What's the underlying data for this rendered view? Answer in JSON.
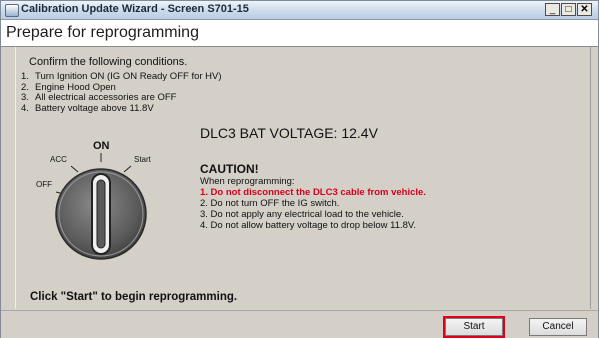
{
  "window": {
    "title": "Calibration Update Wizard - Screen S701-15",
    "controls": {
      "minimize": "_",
      "maximize": "□",
      "close": "✕"
    }
  },
  "header": {
    "title": "Prepare for reprogramming"
  },
  "main": {
    "confirm_text": "Confirm the following conditions.",
    "conditions": [
      {
        "num": "1.",
        "text": "Turn Ignition ON (IG ON Ready OFF for HV)"
      },
      {
        "num": "2.",
        "text": "Engine Hood Open"
      },
      {
        "num": "3.",
        "text": "All electrical accessories are OFF"
      },
      {
        "num": "4.",
        "text": "Battery voltage above 11.8V"
      }
    ],
    "voltage_text": "DLC3 BAT VOLTAGE: 12.4V",
    "ignition": {
      "label_on": "ON",
      "label_acc": "ACC",
      "label_start": "Start",
      "label_off": "OFF"
    },
    "caution": {
      "title": "CAUTION!",
      "intro": "When reprogramming:",
      "items": [
        {
          "text": "1. Do not disconnect the DLC3 cable from vehicle."
        },
        {
          "text": "2. Do not turn OFF the IG switch."
        },
        {
          "text": "3. Do not apply any electrical load to the vehicle."
        },
        {
          "text": "4. Do not allow battery voltage to drop below 11.8V."
        }
      ]
    },
    "instruction": "Click \"Start\" to begin reprogramming."
  },
  "footer": {
    "start_label": "Start",
    "cancel_label": "Cancel"
  },
  "colors": {
    "warning_red": "#d6001c",
    "highlight_red": "#e0001b",
    "panel_gray": "#d4d0c8"
  }
}
